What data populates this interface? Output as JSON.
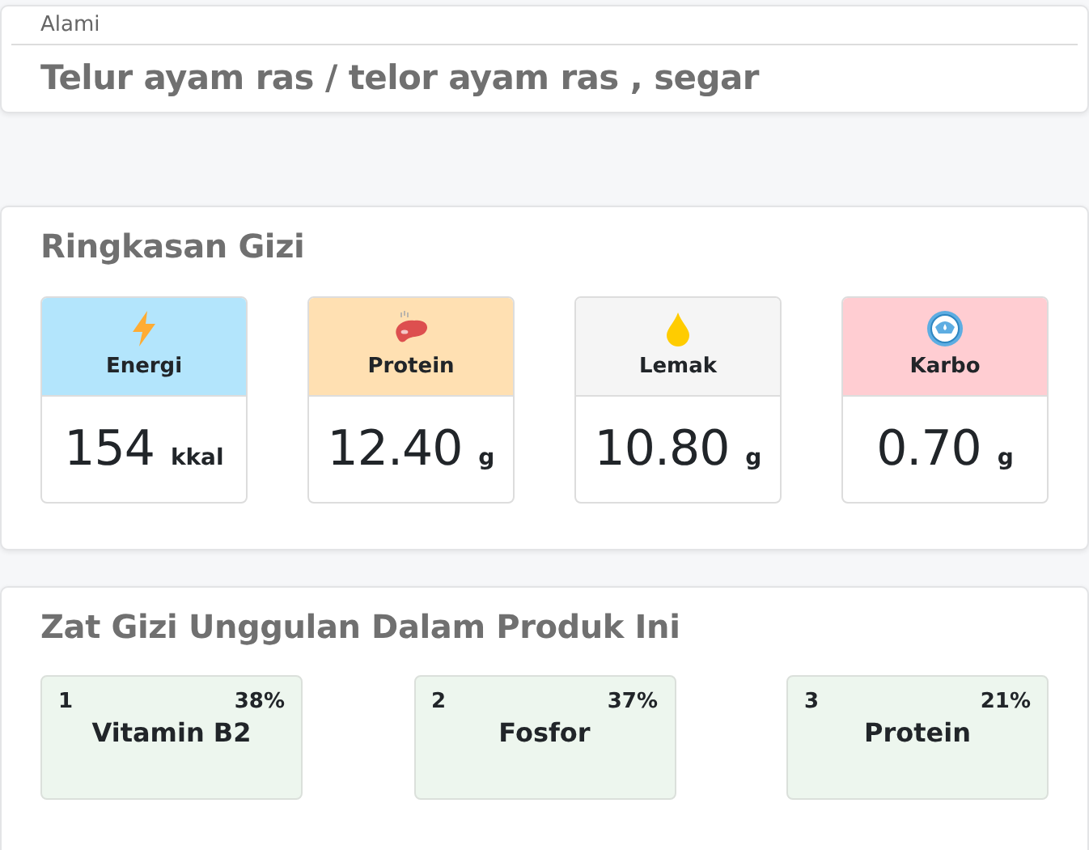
{
  "product": {
    "category": "Alami",
    "name": "Telur ayam ras / telor ayam ras , segar"
  },
  "summary": {
    "title": "Ringkasan Gizi",
    "items": [
      {
        "kind": "energy",
        "label": "Energi",
        "value": "154",
        "unit": "kkal",
        "color": "#b3e5fc"
      },
      {
        "kind": "protein",
        "label": "Protein",
        "value": "12.40",
        "unit": "g",
        "color": "#ffe0b2"
      },
      {
        "kind": "fat",
        "label": "Lemak",
        "value": "10.80",
        "unit": "g",
        "color": "#f5f5f5"
      },
      {
        "kind": "carb",
        "label": "Karbo",
        "value": "0.70",
        "unit": "g",
        "color": "#ffcdd2"
      }
    ]
  },
  "highlights": {
    "title": "Zat Gizi Unggulan Dalam Produk Ini",
    "items": [
      {
        "rank": "1",
        "percent": "38%",
        "name": "Vitamin B2"
      },
      {
        "rank": "2",
        "percent": "37%",
        "name": "Fosfor"
      },
      {
        "rank": "3",
        "percent": "21%",
        "name": "Protein"
      }
    ]
  }
}
